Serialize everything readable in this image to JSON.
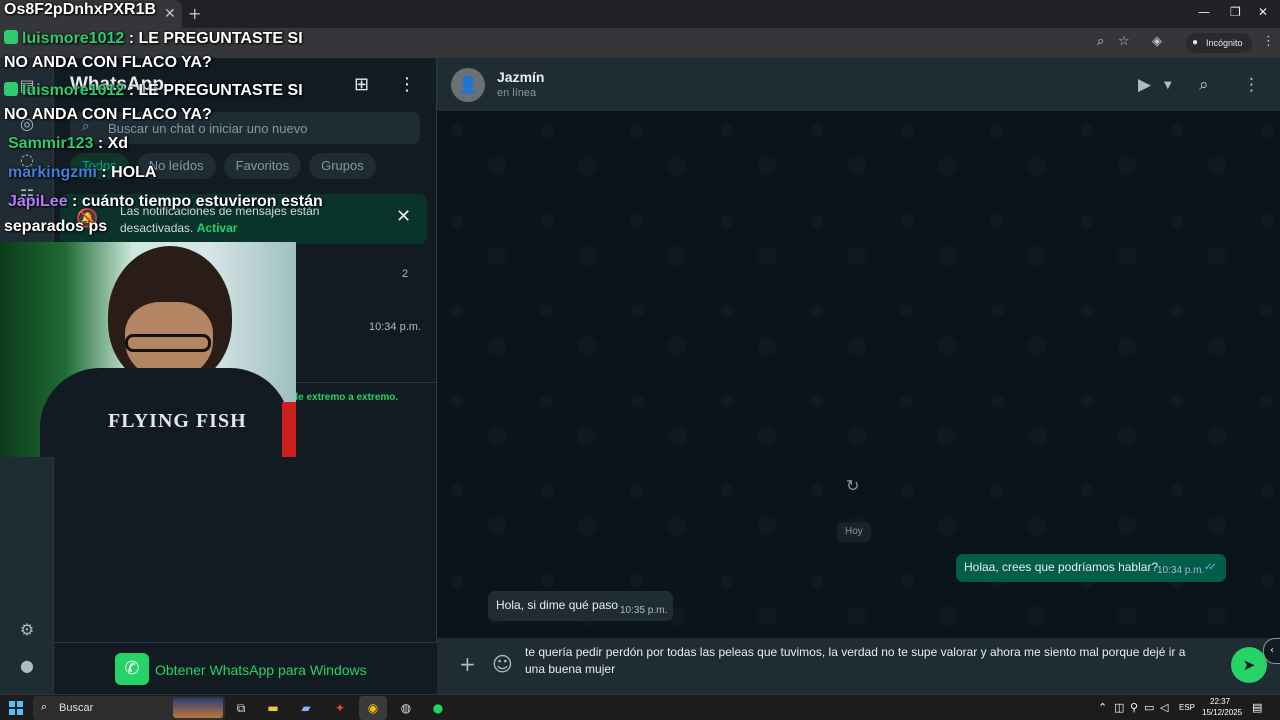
{
  "browser": {
    "tab_title": "Os8F2pDnhxPXR1B",
    "incognito_label": "Incógnito"
  },
  "whatsapp": {
    "app_title": "WhatsApp",
    "search_placeholder": "Buscar un chat o iniciar uno nuevo",
    "filters": [
      "Todos",
      "No leídos",
      "Favoritos",
      "Grupos"
    ],
    "notification": {
      "text": "Las notificaciones de mensajes están desactivadas.",
      "action": "Activar"
    },
    "chat_row": {
      "badge": "2",
      "time": "10:34 p.m."
    },
    "e2e_text": "de extremo a extremo.",
    "get_app": "Obtener WhatsApp para Windows",
    "contact": {
      "name": "Jazmín",
      "status": "en línea"
    },
    "date_divider": "Hoy",
    "messages": [
      {
        "direction": "out",
        "text": "Holaa, crees que podríamos hablar?",
        "time": "10:34 p.m."
      },
      {
        "direction": "in",
        "text": "Hola, si dime qué paso",
        "time": "10:35 p.m."
      }
    ],
    "composer_text": "te quería pedir perdón por todas las peleas que tuvimos, la verdad no te supe valorar y ahora me siento mal porque dejé ir a una buena mujer"
  },
  "stream_chat": [
    {
      "user": "luismore1012",
      "message": " : LE PREGUNTASTE SI",
      "cont": "NO ANDA CON FLACO YA?",
      "color": "green"
    },
    {
      "user": "luismore1012",
      "message": " : LE PREGUNTASTE SI",
      "cont": "NO ANDA CON FLACO YA?",
      "color": "green"
    },
    {
      "user": "Sammir123",
      "message": " : Xd",
      "color": "green"
    },
    {
      "user": "markingzmi",
      "message": " : HOLA",
      "color": "blue"
    },
    {
      "user": "JapiLee",
      "message": " : cuánto tiempo estuvieron están",
      "cont": "separados ps",
      "color": "purple"
    }
  ],
  "webcam": {
    "shirt_text": "FLYING FISH"
  },
  "taskbar": {
    "search_label": "Buscar",
    "language": "ESP",
    "time": "22:37",
    "date": "15/12/2025"
  }
}
